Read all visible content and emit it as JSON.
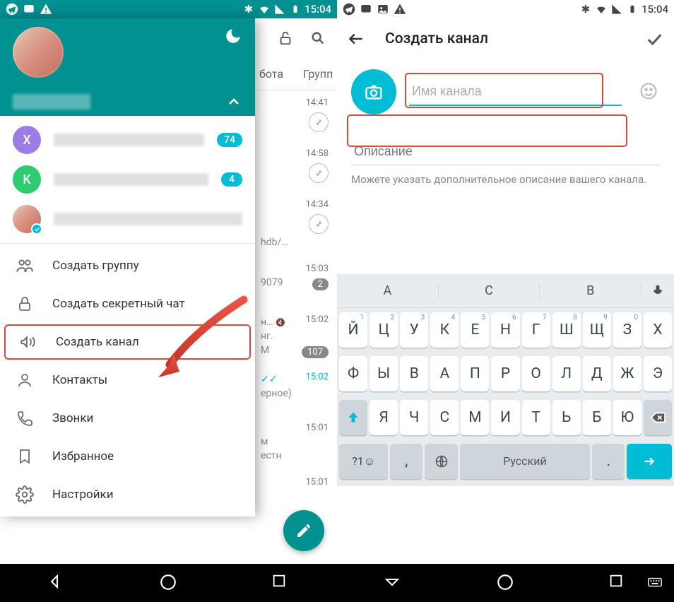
{
  "status": {
    "time": "15:04"
  },
  "drawer": {
    "accounts": [
      {
        "letter": "X",
        "badge": "74"
      },
      {
        "letter": "K",
        "badge": "4"
      },
      {
        "letter": "",
        "badge": ""
      }
    ],
    "menu": {
      "create_group": "Создать группу",
      "create_secret": "Создать секретный чат",
      "create_channel": "Создать канал",
      "contacts": "Контакты",
      "calls": "Звонки",
      "favorites": "Избранное",
      "settings": "Настройки"
    }
  },
  "chat_strip": {
    "tabs": {
      "t1": "бота",
      "t2": "Групп"
    },
    "items": [
      {
        "time": "14:41",
        "pin": true
      },
      {
        "time": "14:58",
        "pin": true
      },
      {
        "time": "14:34",
        "pin": true,
        "snip": "hdb/…"
      },
      {
        "time": "15:03",
        "badge": "2",
        "snip": "9079"
      },
      {
        "time": "15:02",
        "badge": "107",
        "snip": "н…",
        "snip2": "нг.",
        "snip3": "М"
      },
      {
        "time": "15:02",
        "checks": true,
        "snip": "ерное)"
      },
      {
        "time": "15:01",
        "snip": "м",
        "snip2": "естн"
      },
      {
        "time": "15:01"
      }
    ]
  },
  "create": {
    "title": "Создать канал",
    "name_placeholder": "Имя канала",
    "desc_placeholder": "Описание",
    "hint": "Можете указать дополнительное описание вашего канала."
  },
  "keyboard": {
    "suggestions": [
      "А",
      "С",
      "В"
    ],
    "row1": [
      {
        "k": "Й",
        "s": "1"
      },
      {
        "k": "Ц",
        "s": "2"
      },
      {
        "k": "У",
        "s": "3"
      },
      {
        "k": "К",
        "s": "4"
      },
      {
        "k": "Е",
        "s": "5"
      },
      {
        "k": "Н",
        "s": "6"
      },
      {
        "k": "Г",
        "s": "7"
      },
      {
        "k": "Ш",
        "s": "8"
      },
      {
        "k": "Щ",
        "s": "9"
      },
      {
        "k": "З",
        "s": "0"
      },
      {
        "k": "Х",
        "s": ""
      }
    ],
    "row2": [
      "Ф",
      "Ы",
      "В",
      "А",
      "П",
      "Р",
      "О",
      "Л",
      "Д",
      "Ж",
      "Э"
    ],
    "row3": [
      "Я",
      "Ч",
      "С",
      "М",
      "И",
      "Т",
      "Ь",
      "Б",
      "Ю"
    ],
    "sym": "?1☺",
    "comma": ",",
    "space": "Русский",
    "dot": "."
  }
}
